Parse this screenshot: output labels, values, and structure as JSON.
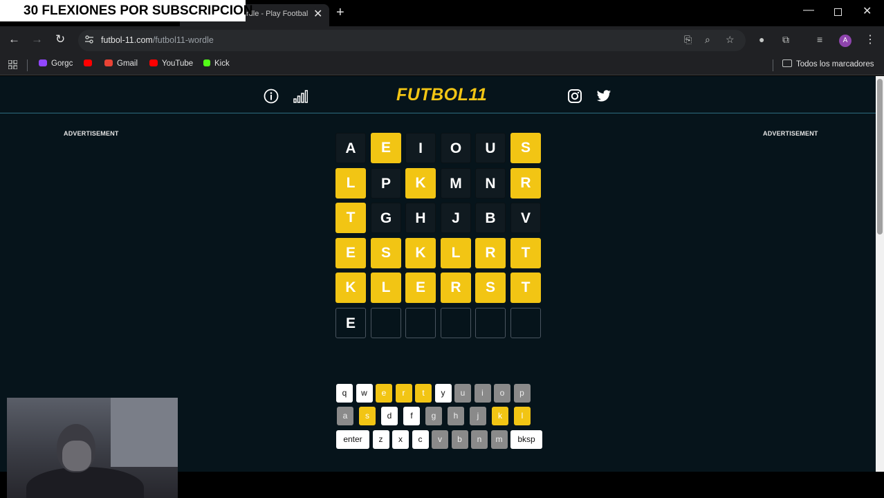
{
  "overlay": {
    "text": "30 FLEXIONES POR SUBSCRIPCION"
  },
  "tab": {
    "title": "rdle - Play Footbal"
  },
  "address": {
    "domain": "futbol-11.com",
    "path": "/futbol11-wordle"
  },
  "bookmarks": {
    "items": [
      {
        "label": "Gorgc",
        "icon": "twitch-icon",
        "color": "#9146ff"
      },
      {
        "label": "",
        "icon": "youtube-icon",
        "color": "#ff0000"
      },
      {
        "label": "Gmail",
        "icon": "gmail-icon",
        "color": "#ea4335"
      },
      {
        "label": "YouTube",
        "icon": "youtube-icon",
        "color": "#ff0000"
      },
      {
        "label": "Kick",
        "icon": "kick-icon",
        "color": "#53fc18"
      }
    ],
    "all_label": "Todos los marcadores"
  },
  "site": {
    "logo": "FUTBOL11",
    "ad_left": "ADVERTISEMENT",
    "ad_right": "ADVERTISEMENT"
  },
  "board": {
    "rows": [
      [
        {
          "l": "A",
          "s": "absent"
        },
        {
          "l": "E",
          "s": "present"
        },
        {
          "l": "I",
          "s": "absent"
        },
        {
          "l": "O",
          "s": "absent"
        },
        {
          "l": "U",
          "s": "absent"
        },
        {
          "l": "S",
          "s": "present"
        }
      ],
      [
        {
          "l": "L",
          "s": "present"
        },
        {
          "l": "P",
          "s": "absent"
        },
        {
          "l": "K",
          "s": "present"
        },
        {
          "l": "M",
          "s": "absent"
        },
        {
          "l": "N",
          "s": "absent"
        },
        {
          "l": "R",
          "s": "present"
        }
      ],
      [
        {
          "l": "T",
          "s": "present"
        },
        {
          "l": "G",
          "s": "absent"
        },
        {
          "l": "H",
          "s": "absent"
        },
        {
          "l": "J",
          "s": "absent"
        },
        {
          "l": "B",
          "s": "absent"
        },
        {
          "l": "V",
          "s": "absent"
        }
      ],
      [
        {
          "l": "E",
          "s": "present"
        },
        {
          "l": "S",
          "s": "present"
        },
        {
          "l": "K",
          "s": "present"
        },
        {
          "l": "L",
          "s": "present"
        },
        {
          "l": "R",
          "s": "present"
        },
        {
          "l": "T",
          "s": "present"
        }
      ],
      [
        {
          "l": "K",
          "s": "present"
        },
        {
          "l": "L",
          "s": "present"
        },
        {
          "l": "E",
          "s": "present"
        },
        {
          "l": "R",
          "s": "present"
        },
        {
          "l": "S",
          "s": "present"
        },
        {
          "l": "T",
          "s": "present"
        }
      ],
      [
        {
          "l": "E",
          "s": "empty"
        },
        {
          "l": "",
          "s": "empty"
        },
        {
          "l": "",
          "s": "empty"
        },
        {
          "l": "",
          "s": "empty"
        },
        {
          "l": "",
          "s": "empty"
        },
        {
          "l": "",
          "s": "empty"
        }
      ]
    ]
  },
  "keyboard": {
    "rows": [
      [
        {
          "k": "q",
          "s": "w"
        },
        {
          "k": "w",
          "s": "w"
        },
        {
          "k": "e",
          "s": "y"
        },
        {
          "k": "r",
          "s": "y"
        },
        {
          "k": "t",
          "s": "y"
        },
        {
          "k": "y",
          "s": "w"
        },
        {
          "k": "u",
          "s": "g"
        },
        {
          "k": "i",
          "s": "g"
        },
        {
          "k": "o",
          "s": "g"
        },
        {
          "k": "p",
          "s": "g"
        }
      ],
      [
        {
          "k": "a",
          "s": "g"
        },
        {
          "k": "s",
          "s": "y"
        },
        {
          "k": "d",
          "s": "w"
        },
        {
          "k": "f",
          "s": "w"
        },
        {
          "k": "g",
          "s": "g"
        },
        {
          "k": "h",
          "s": "g"
        },
        {
          "k": "j",
          "s": "g"
        },
        {
          "k": "k",
          "s": "y"
        },
        {
          "k": "l",
          "s": "y"
        }
      ],
      [
        {
          "k": "enter",
          "s": "w"
        },
        {
          "k": "z",
          "s": "w"
        },
        {
          "k": "x",
          "s": "w"
        },
        {
          "k": "c",
          "s": "w"
        },
        {
          "k": "v",
          "s": "g"
        },
        {
          "k": "b",
          "s": "g"
        },
        {
          "k": "n",
          "s": "g"
        },
        {
          "k": "m",
          "s": "g"
        },
        {
          "k": "bksp",
          "s": "w"
        }
      ]
    ]
  },
  "colors": {
    "present": "#f2c514",
    "page_bg": "#06141b",
    "accent_line": "#2f6e82"
  }
}
